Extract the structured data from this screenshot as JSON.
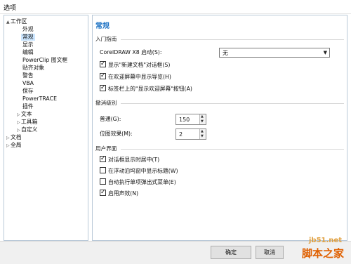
{
  "window": {
    "title": "选项"
  },
  "tree": {
    "root": "工作区",
    "items": [
      "外观",
      "常规",
      "显示",
      "编辑",
      "PowerClip 图文框",
      "贴齐对象",
      "警告",
      "VBA",
      "保存",
      "PowerTRACE",
      "插件"
    ],
    "groups": [
      "文本",
      "工具箱",
      "自定义"
    ],
    "top_level": [
      "文档",
      "全局"
    ],
    "selected": "常规"
  },
  "panel": {
    "title": "常规",
    "intro_section": {
      "heading": "入门指南",
      "startup_label": "CorelDRAW X8 启动(S):",
      "startup_value": "无",
      "options": [
        {
          "label": "显示\"新建文档\"对话框(S)",
          "checked": true
        },
        {
          "label": "在欢迎屏幕中显示导览(H)",
          "checked": true
        },
        {
          "label": "标签栏上的\"显示欢迎屏幕\"按钮(A)",
          "checked": true
        }
      ]
    },
    "undo_section": {
      "heading": "撤消级别",
      "normal_label": "普通(G):",
      "normal_value": "150",
      "bitmap_label": "位图效果(M):",
      "bitmap_value": "2"
    },
    "ui_section": {
      "heading": "用户界面",
      "options": [
        {
          "label": "对话框显示时居中(T)",
          "checked": true
        },
        {
          "label": "在浮动泊坞窗中显示标题(W)",
          "checked": false
        },
        {
          "label": "自动执行单项弹出式菜单(E)",
          "checked": false
        },
        {
          "label": "启用声效(N)",
          "checked": true
        }
      ]
    }
  },
  "footer": {
    "ok_label": "确定",
    "cancel_label": "取消"
  },
  "watermark": {
    "line1": "jb51.net",
    "line2": "脚本之家"
  }
}
